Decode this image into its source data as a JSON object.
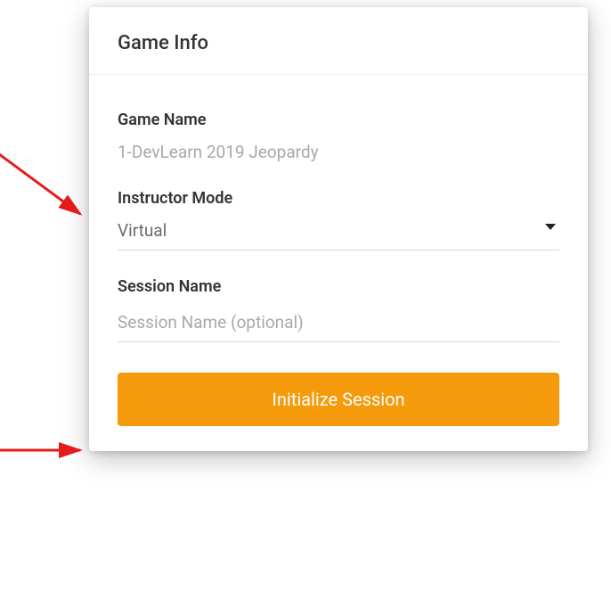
{
  "header": {
    "title": "Game Info"
  },
  "fields": {
    "gameName": {
      "label": "Game Name",
      "value": "1-DevLearn 2019 Jeopardy"
    },
    "instructorMode": {
      "label": "Instructor Mode",
      "selected": "Virtual"
    },
    "sessionName": {
      "label": "Session Name",
      "placeholder": "Session Name (optional)",
      "value": ""
    }
  },
  "actions": {
    "initialize": "Initialize Session"
  },
  "annotations": {
    "arrow1": {
      "target": "instructor-mode-area"
    },
    "arrow2": {
      "target": "session-name-area"
    }
  },
  "colors": {
    "accent": "#f59a0b",
    "arrow": "#e21b1b"
  }
}
